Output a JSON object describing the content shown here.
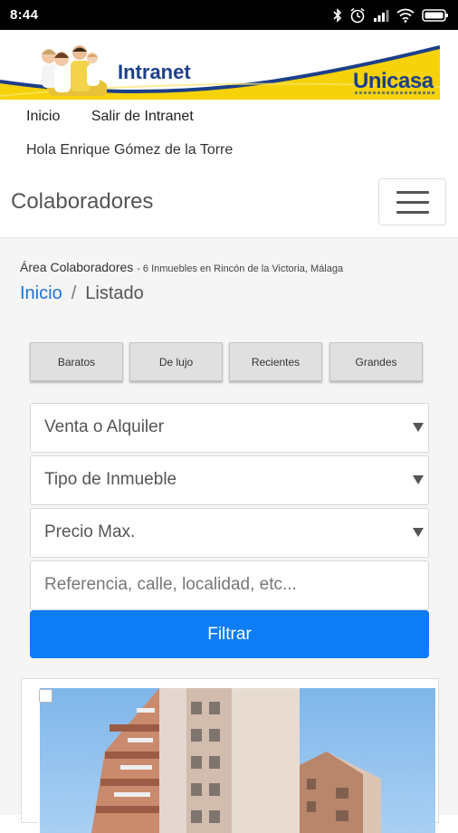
{
  "status_bar": {
    "time": "8:44",
    "icons": [
      "bluetooth-icon",
      "alarm-icon",
      "signal-icon",
      "wifi-icon",
      "battery-icon"
    ]
  },
  "banner": {
    "title": "Intranet",
    "brand": "Unicasa",
    "colors": {
      "blue": "#1c3f8a",
      "yellow": "#f5d20a"
    }
  },
  "top_links": {
    "home": "Inicio",
    "logout": "Salir de Intranet"
  },
  "greeting": "Hola Enrique Gómez de la Torre",
  "navbar": {
    "title": "Colaboradores",
    "menu_icon": "hamburger-icon"
  },
  "breadcrumb": {
    "area": "Área Colaboradores",
    "summary": "- 6 Inmuebles en Rincón de la Victoria, Málaga",
    "home": "Inicio",
    "separator": "/",
    "current": "Listado"
  },
  "quick_filters": [
    "Baratos",
    "De lujo",
    "Recientes",
    "Grandes"
  ],
  "filters": {
    "operation": "Venta o Alquiler",
    "type": "Tipo de Inmueble",
    "max_price": "Precio Max.",
    "search_placeholder": "Referencia, calle, localidad, etc...",
    "submit": "Filtrar"
  },
  "colors": {
    "primary": "#0d7cf5",
    "link": "#1d74d8",
    "background": "#f5f5f5"
  }
}
